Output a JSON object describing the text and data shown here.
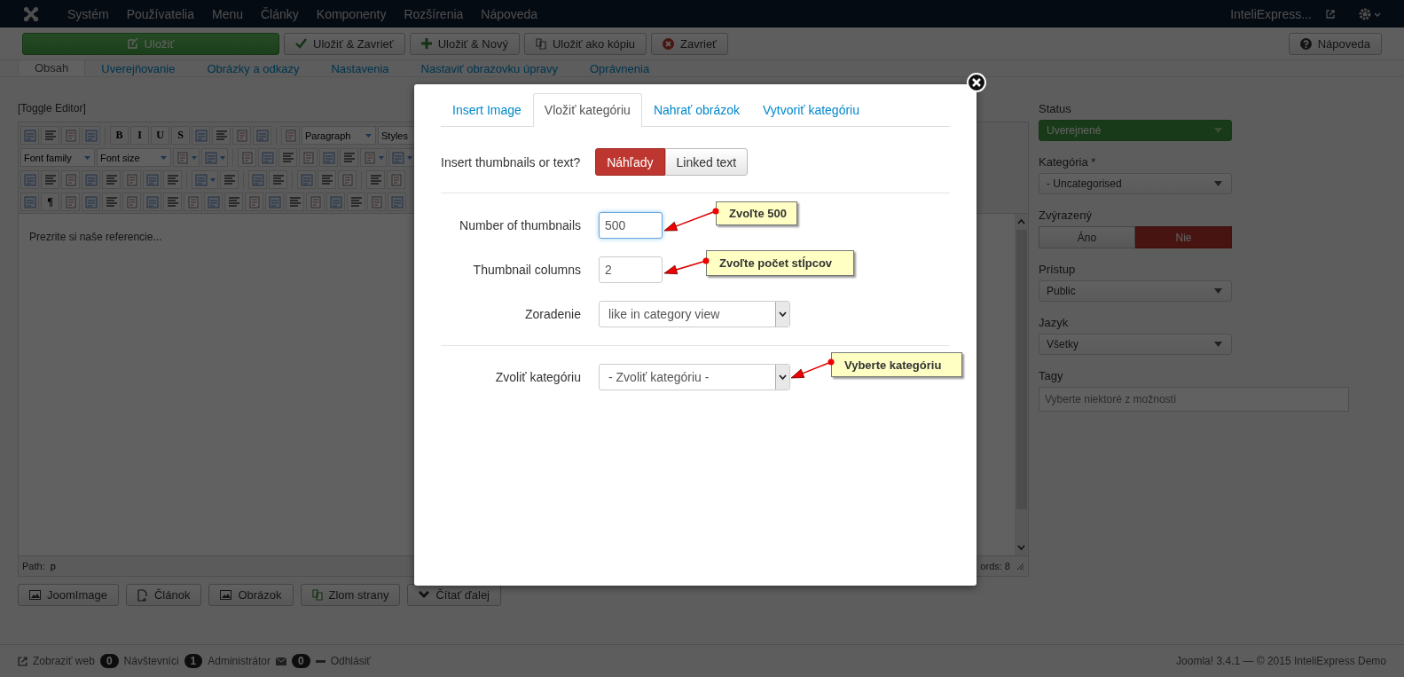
{
  "navbar": {
    "menu": [
      "Systém",
      "Používatelia",
      "Menu",
      "Články",
      "Komponenty",
      "Rozšírenia",
      "Nápoveda"
    ],
    "site": "InteliExpress..."
  },
  "toolbar": {
    "buttons": [
      {
        "label": "Uložiť",
        "kind": "save"
      },
      {
        "label": "Uložiť & Zavrieť",
        "kind": "check"
      },
      {
        "label": "Uložiť & Nový",
        "kind": "plus"
      },
      {
        "label": "Uložiť ako kópiu",
        "kind": "copy"
      },
      {
        "label": "Zavrieť",
        "kind": "close"
      }
    ],
    "help": "Nápoveda"
  },
  "tabs": [
    {
      "label": "Obsah",
      "selected": true
    },
    {
      "label": "Uverejňovanie",
      "selected": false
    },
    {
      "label": "Obrázky a odkazy",
      "selected": false
    },
    {
      "label": "Nastavenia",
      "selected": false
    },
    {
      "label": "Nastaviť obrazovku úpravy",
      "selected": false
    },
    {
      "label": "Oprávnenia",
      "selected": false
    }
  ],
  "editor": {
    "toggle": "[Toggle Editor]",
    "toolbar_rows": [
      [
        {
          "kind": "icon"
        },
        {
          "kind": "icon"
        },
        {
          "kind": "icon"
        },
        {
          "kind": "icon"
        },
        {
          "kind": "sep"
        },
        {
          "kind": "char",
          "label": "B"
        },
        {
          "kind": "char",
          "label": "I"
        },
        {
          "kind": "char",
          "label": "U"
        },
        {
          "kind": "char",
          "label": "S"
        },
        {
          "kind": "icon"
        },
        {
          "kind": "icon"
        },
        {
          "kind": "icon"
        },
        {
          "kind": "icon"
        },
        {
          "kind": "sep"
        },
        {
          "kind": "icon"
        },
        {
          "kind": "select",
          "label": "Paragraph"
        },
        {
          "kind": "select",
          "label": "Styles"
        }
      ],
      [
        {
          "kind": "select",
          "label": "Font family"
        },
        {
          "kind": "select",
          "label": "Font size"
        },
        {
          "kind": "split"
        },
        {
          "kind": "split"
        },
        {
          "kind": "sep"
        },
        {
          "kind": "icon"
        },
        {
          "kind": "icon"
        },
        {
          "kind": "icon"
        },
        {
          "kind": "icon"
        },
        {
          "kind": "icon"
        },
        {
          "kind": "icon"
        },
        {
          "kind": "split"
        },
        {
          "kind": "split"
        }
      ],
      [
        {
          "kind": "icon"
        },
        {
          "kind": "icon"
        },
        {
          "kind": "icon"
        },
        {
          "kind": "icon"
        },
        {
          "kind": "icon"
        },
        {
          "kind": "icon"
        },
        {
          "kind": "icon"
        },
        {
          "kind": "icon"
        },
        {
          "kind": "sep"
        },
        {
          "kind": "split"
        },
        {
          "kind": "icon"
        },
        {
          "kind": "sep"
        },
        {
          "kind": "icon"
        },
        {
          "kind": "icon"
        },
        {
          "kind": "sep"
        },
        {
          "kind": "icon"
        },
        {
          "kind": "icon"
        },
        {
          "kind": "icon"
        },
        {
          "kind": "sep"
        },
        {
          "kind": "icon"
        },
        {
          "kind": "icon"
        }
      ],
      [
        {
          "kind": "icon"
        },
        {
          "kind": "char",
          "label": "¶"
        },
        {
          "kind": "icon"
        },
        {
          "kind": "icon"
        },
        {
          "kind": "icon"
        },
        {
          "kind": "icon"
        },
        {
          "kind": "icon"
        },
        {
          "kind": "icon"
        },
        {
          "kind": "icon"
        },
        {
          "kind": "icon"
        },
        {
          "kind": "icon"
        },
        {
          "kind": "icon"
        },
        {
          "kind": "icon"
        },
        {
          "kind": "icon"
        },
        {
          "kind": "icon"
        },
        {
          "kind": "icon"
        },
        {
          "kind": "icon"
        },
        {
          "kind": "icon"
        },
        {
          "kind": "icon"
        }
      ]
    ],
    "content": "Prezrite si naše referencie...",
    "path_label": "Path:",
    "path": "p",
    "words": "ords: 8"
  },
  "editor_buttons": [
    {
      "label": "JoomImage",
      "kind": "image"
    },
    {
      "label": "Článok",
      "kind": "doc"
    },
    {
      "label": "Obrázok",
      "kind": "image"
    },
    {
      "label": "Zlom strany",
      "kind": "copy"
    },
    {
      "label": "Čítať ďalej",
      "kind": "chevron"
    }
  ],
  "sidebar": {
    "fields": [
      {
        "label": "Status",
        "kind": "select",
        "value": "Uverejnené",
        "success": true
      },
      {
        "label": "Kategória *",
        "kind": "select",
        "value": "- Uncategorised",
        "success": false
      },
      {
        "label": "Zvýrazený",
        "kind": "toggle",
        "options": [
          {
            "label": "Áno",
            "selected": false
          },
          {
            "label": "Nie",
            "selected": true
          }
        ]
      },
      {
        "label": "Prístup",
        "kind": "select",
        "value": "Public",
        "success": false
      },
      {
        "label": "Jazyk",
        "kind": "select",
        "value": "Všetky",
        "success": false
      },
      {
        "label": "Tagy",
        "kind": "input",
        "placeholder": "Vyberte niektoré z možností"
      }
    ]
  },
  "status_bar": {
    "view_site": "Zobraziť web",
    "visitors_count": "0",
    "visitors": "Návštevníci",
    "admins_count": "1",
    "admins": "Administrátor",
    "messages_count": "0",
    "logout": "Odhlásiť",
    "copyright": "Joomla! 3.4.1 — © 2015 InteliExpress Demo"
  },
  "modal": {
    "tabs": [
      {
        "label": "Insert Image",
        "selected": false
      },
      {
        "label": "Vložiť kategóriu",
        "selected": true
      },
      {
        "label": "Nahrať obrázok",
        "selected": false
      },
      {
        "label": "Vytvoriť kategóriu",
        "selected": false
      }
    ],
    "mode_label": "Insert thumbnails or text?",
    "modes": [
      {
        "label": "Náhľady",
        "selected": true
      },
      {
        "label": "Linked text",
        "selected": false
      }
    ],
    "fields": [
      {
        "label": "Number of thumbnails",
        "kind": "input",
        "value": "500",
        "focused": true
      },
      {
        "label": "Thumbnail columns",
        "kind": "input",
        "value": "2",
        "focused": false
      },
      {
        "label": "Zoradenie",
        "kind": "select",
        "value": "like in category view"
      },
      {
        "label": "Zvoliť kategóriu",
        "kind": "select",
        "value": "- Zvoliť kategóriu -",
        "divider_before": true
      }
    ],
    "callouts": [
      "Zvoľte 500",
      "Zvoľte počet stĺpcov",
      "Vyberte kategóriu"
    ]
  }
}
